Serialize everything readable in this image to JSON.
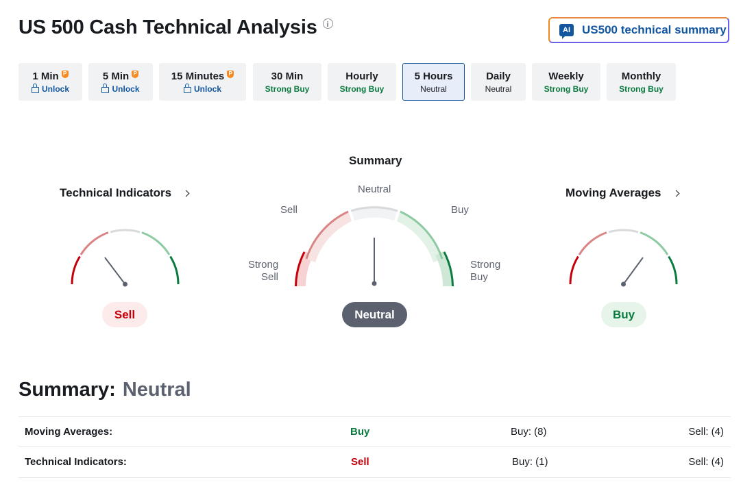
{
  "header": {
    "title": "US 500 Cash Technical Analysis",
    "ai_badge": "AI",
    "ai_button_label": "US500 technical summary"
  },
  "tabs": [
    {
      "label": "1 Min",
      "status": "Unlock",
      "locked": true,
      "status_color": "#1256a0"
    },
    {
      "label": "5 Min",
      "status": "Unlock",
      "locked": true,
      "status_color": "#1256a0"
    },
    {
      "label": "15 Minutes",
      "status": "Unlock",
      "locked": true,
      "status_color": "#1256a0"
    },
    {
      "label": "30 Min",
      "status": "Strong Buy",
      "locked": false,
      "status_color": "#0a7b3e"
    },
    {
      "label": "Hourly",
      "status": "Strong Buy",
      "locked": false,
      "status_color": "#0a7b3e"
    },
    {
      "label": "5 Hours",
      "status": "Neutral",
      "locked": false,
      "active": true,
      "status_color": "#181c21"
    },
    {
      "label": "Daily",
      "status": "Neutral",
      "locked": false,
      "status_color": "#181c21"
    },
    {
      "label": "Weekly",
      "status": "Strong Buy",
      "locked": false,
      "status_color": "#0a7b3e"
    },
    {
      "label": "Monthly",
      "status": "Strong Buy",
      "locked": false,
      "status_color": "#0a7b3e"
    }
  ],
  "gauges": {
    "summary_heading": "Summary",
    "technical": {
      "title": "Technical Indicators",
      "result": "Sell"
    },
    "summary": {
      "result": "Neutral",
      "labels": {
        "neutral": "Neutral",
        "sell": "Sell",
        "buy": "Buy",
        "strong_sell_1": "Strong",
        "strong_sell_2": "Sell",
        "strong_buy_1": "Strong",
        "strong_buy_2": "Buy"
      }
    },
    "moving": {
      "title": "Moving Averages",
      "result": "Buy"
    }
  },
  "summary": {
    "label": "Summary:",
    "value": "Neutral",
    "rows": [
      {
        "name": "Moving Averages:",
        "signal": "Buy",
        "signal_color": "#0a7b3e",
        "buy": "Buy: (8)",
        "sell": "Sell: (4)"
      },
      {
        "name": "Technical Indicators:",
        "signal": "Sell",
        "signal_color": "#c5000a",
        "buy": "Buy: (1)",
        "sell": "Sell: (4)"
      }
    ]
  },
  "colors": {
    "strong_sell": "#c5000a",
    "sell": "#d98585",
    "neutral": "#d9dadc",
    "buy": "#8dcaa2",
    "strong_buy": "#0a7b3e",
    "sell_pill_bg": "#fdeaea",
    "buy_pill_bg": "#e6f4ea",
    "neutral_pill_bg": "#5b616e"
  }
}
